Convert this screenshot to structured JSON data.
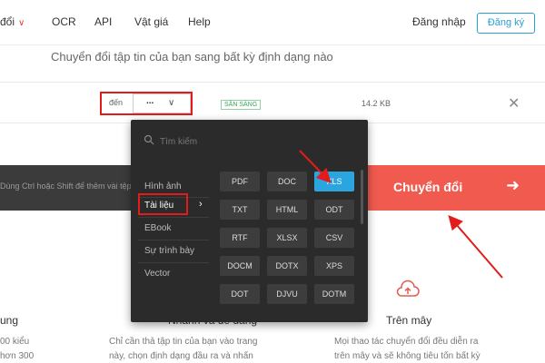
{
  "nav": {
    "convert": "đổi",
    "ocr": "OCR",
    "api": "API",
    "price": "Vật giá",
    "help": "Help",
    "login": "Đăng nhập",
    "signup": "Đăng ký"
  },
  "subtitle": "Chuyển đổi tập tin của bạn sang bất kỳ định dạng nào",
  "file_row": {
    "to_label": "đến",
    "selected_format": "...",
    "status": "SẴN SÀNG",
    "size": "14.2 KB"
  },
  "drop_bar": {
    "hint": "Dùng Ctrl hoặc Shift để thêm vài tệp"
  },
  "convert_button": "Chuyển đổi",
  "dropdown": {
    "search_placeholder": "Tìm kiếm",
    "categories": [
      "Hình ảnh",
      "Tài liệu",
      "EBook",
      "Sự trình bày",
      "Vector"
    ],
    "formats": [
      "PDF",
      "DOC",
      "XLS",
      "TXT",
      "HTML",
      "ODT",
      "RTF",
      "XLSX",
      "CSV",
      "DOCM",
      "DOTX",
      "XPS",
      "DOT",
      "DJVU",
      "DOTM"
    ],
    "selected_format": "XLS"
  },
  "features": {
    "left_title": "ung",
    "left_text_1": "00 kiểu",
    "left_text_2": "hơn 300",
    "middle_title": "Nhanh và dễ dàng",
    "middle_text_1": "Chỉ cần thả tập tin của bạn vào trang",
    "middle_text_2": "này, chọn định dạng đầu ra và nhấn",
    "right_title": "Trên mây",
    "right_text_1": "Mọi thao tác chuyển đổi đều diễn ra",
    "right_text_2": "trên mây và sẽ không tiêu tốn bất kỳ"
  },
  "colors": {
    "accent_red": "#f15a4f",
    "annotation_red": "#e21b1b",
    "selected_blue": "#2aa5e0",
    "panel_dark": "#2b2b2b"
  },
  "icons": [
    "chevron-down-icon",
    "search-icon",
    "close-icon",
    "arrow-right-icon",
    "cloud-upload-icon"
  ]
}
